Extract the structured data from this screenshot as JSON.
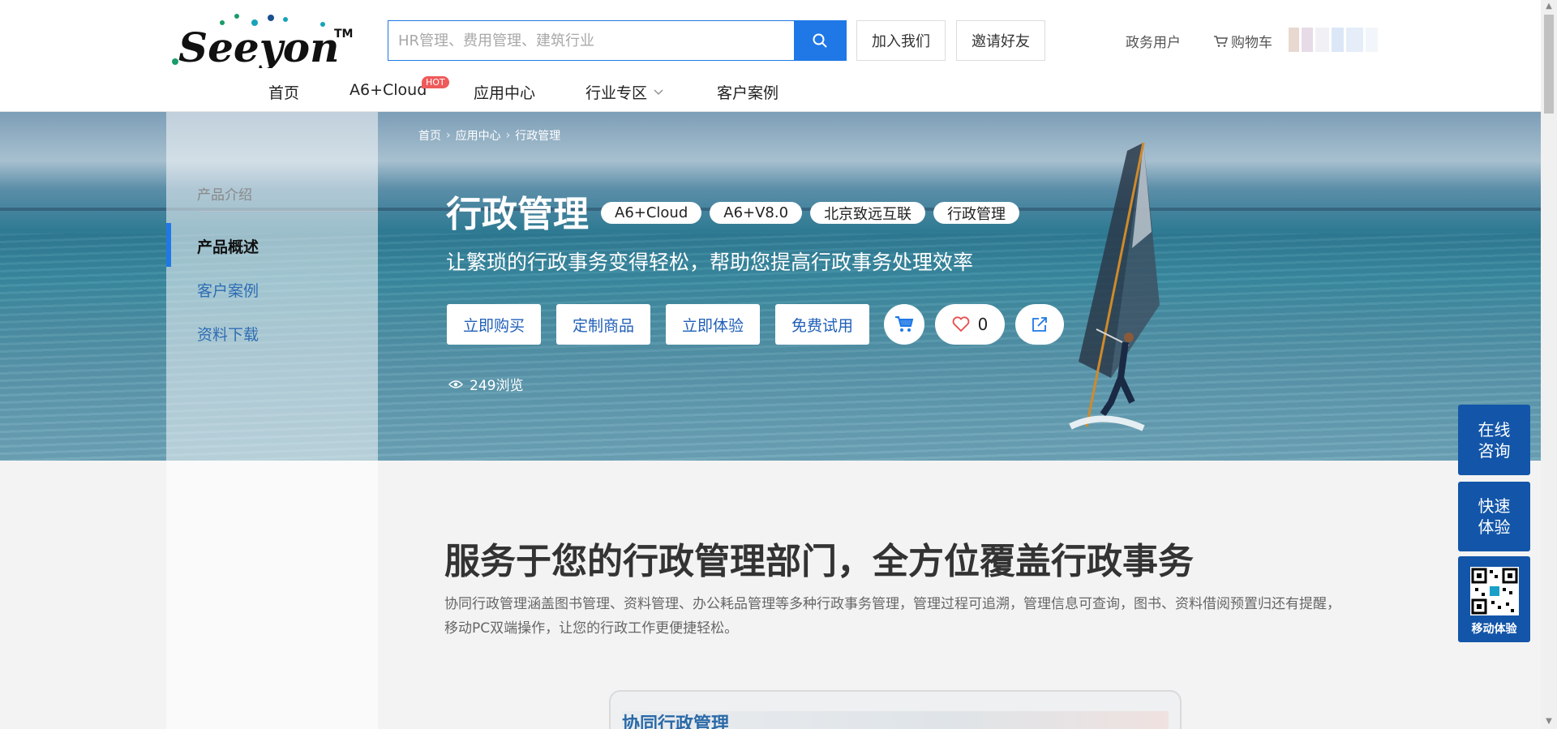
{
  "header": {
    "logo_text": "Seeyon",
    "logo_mark": "TM",
    "search_placeholder": "HR管理、费用管理、建筑行业",
    "join_label": "加入我们",
    "invite_label": "邀请好友",
    "gov_label": "政务用户",
    "cart_label": "购物车"
  },
  "nav": {
    "items": [
      "首页",
      "A6+Cloud",
      "应用中心",
      "行业专区",
      "客户案例"
    ],
    "hot_badge": "HOT"
  },
  "sidebar": {
    "title": "产品介绍",
    "items": [
      "产品概述",
      "客户案例",
      "资料下载"
    ],
    "active": "产品概述"
  },
  "breadcrumb": [
    "首页",
    "应用中心",
    "行政管理"
  ],
  "product": {
    "title": "行政管理",
    "tags": [
      "A6+Cloud",
      "A6+V8.0",
      "北京致远互联",
      "行政管理"
    ],
    "subtitle": "让繁琐的行政事务变得轻松，帮助您提高行政事务处理效率",
    "actions": [
      "立即购买",
      "定制商品",
      "立即体验",
      "免费试用"
    ],
    "likes": "0",
    "views": "249浏览"
  },
  "section": {
    "title": "服务于您的行政管理部门，全方位覆盖行政事务",
    "description": "协同行政管理涵盖图书管理、资料管理、办公耗品管理等多种行政事务管理，管理过程可追溯，管理信息可查询，图书、资料借阅预置归还有提醒，移动PC双端操作，让您的行政工作更便捷轻松。",
    "preview_label": "协同行政管理"
  },
  "floating": {
    "consult": "在线咨询",
    "trial": "快速体验",
    "mobile": "移动体验"
  },
  "colors": {
    "accent": "#1f78e6",
    "float_bg": "#1356a9",
    "hot": "#ee5a5a"
  }
}
